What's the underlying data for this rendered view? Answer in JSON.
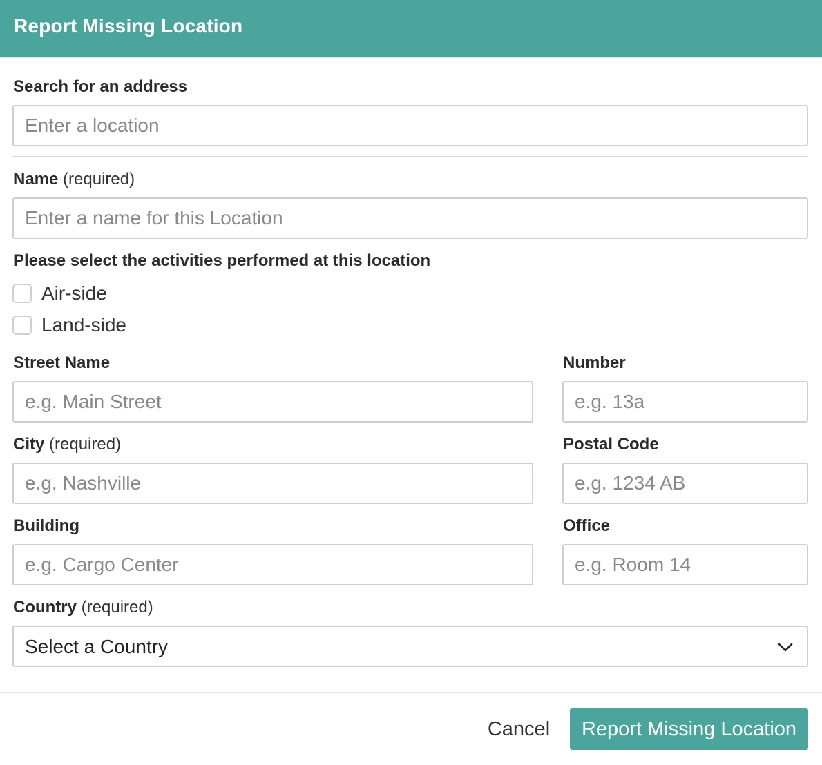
{
  "dialog": {
    "title": "Report Missing Location"
  },
  "search": {
    "label": "Search for an address",
    "placeholder": "Enter a location"
  },
  "name": {
    "label": "Name",
    "hint": "(required)",
    "placeholder": "Enter a name for this Location"
  },
  "activities": {
    "label": "Please select the activities performed at this location",
    "options": [
      {
        "label": "Air-side",
        "checked": false
      },
      {
        "label": "Land-side",
        "checked": false
      }
    ]
  },
  "street": {
    "label": "Street Name",
    "placeholder": "e.g. Main Street"
  },
  "number": {
    "label": "Number",
    "placeholder": "e.g. 13a"
  },
  "city": {
    "label": "City",
    "hint": "(required)",
    "placeholder": "e.g. Nashville"
  },
  "postal": {
    "label": "Postal Code",
    "placeholder": "e.g. 1234 AB"
  },
  "building": {
    "label": "Building",
    "placeholder": "e.g. Cargo Center"
  },
  "office": {
    "label": "Office",
    "placeholder": "e.g. Room 14"
  },
  "country": {
    "label": "Country",
    "hint": "(required)",
    "selected": "Select a Country",
    "icon": "chevron-down-icon"
  },
  "footer": {
    "cancel_label": "Cancel",
    "submit_label": "Report Missing Location"
  },
  "colors": {
    "accent": "#4ba59d",
    "border": "#cfcfcf",
    "text": "#333333",
    "placeholder": "#8a8a8a"
  }
}
